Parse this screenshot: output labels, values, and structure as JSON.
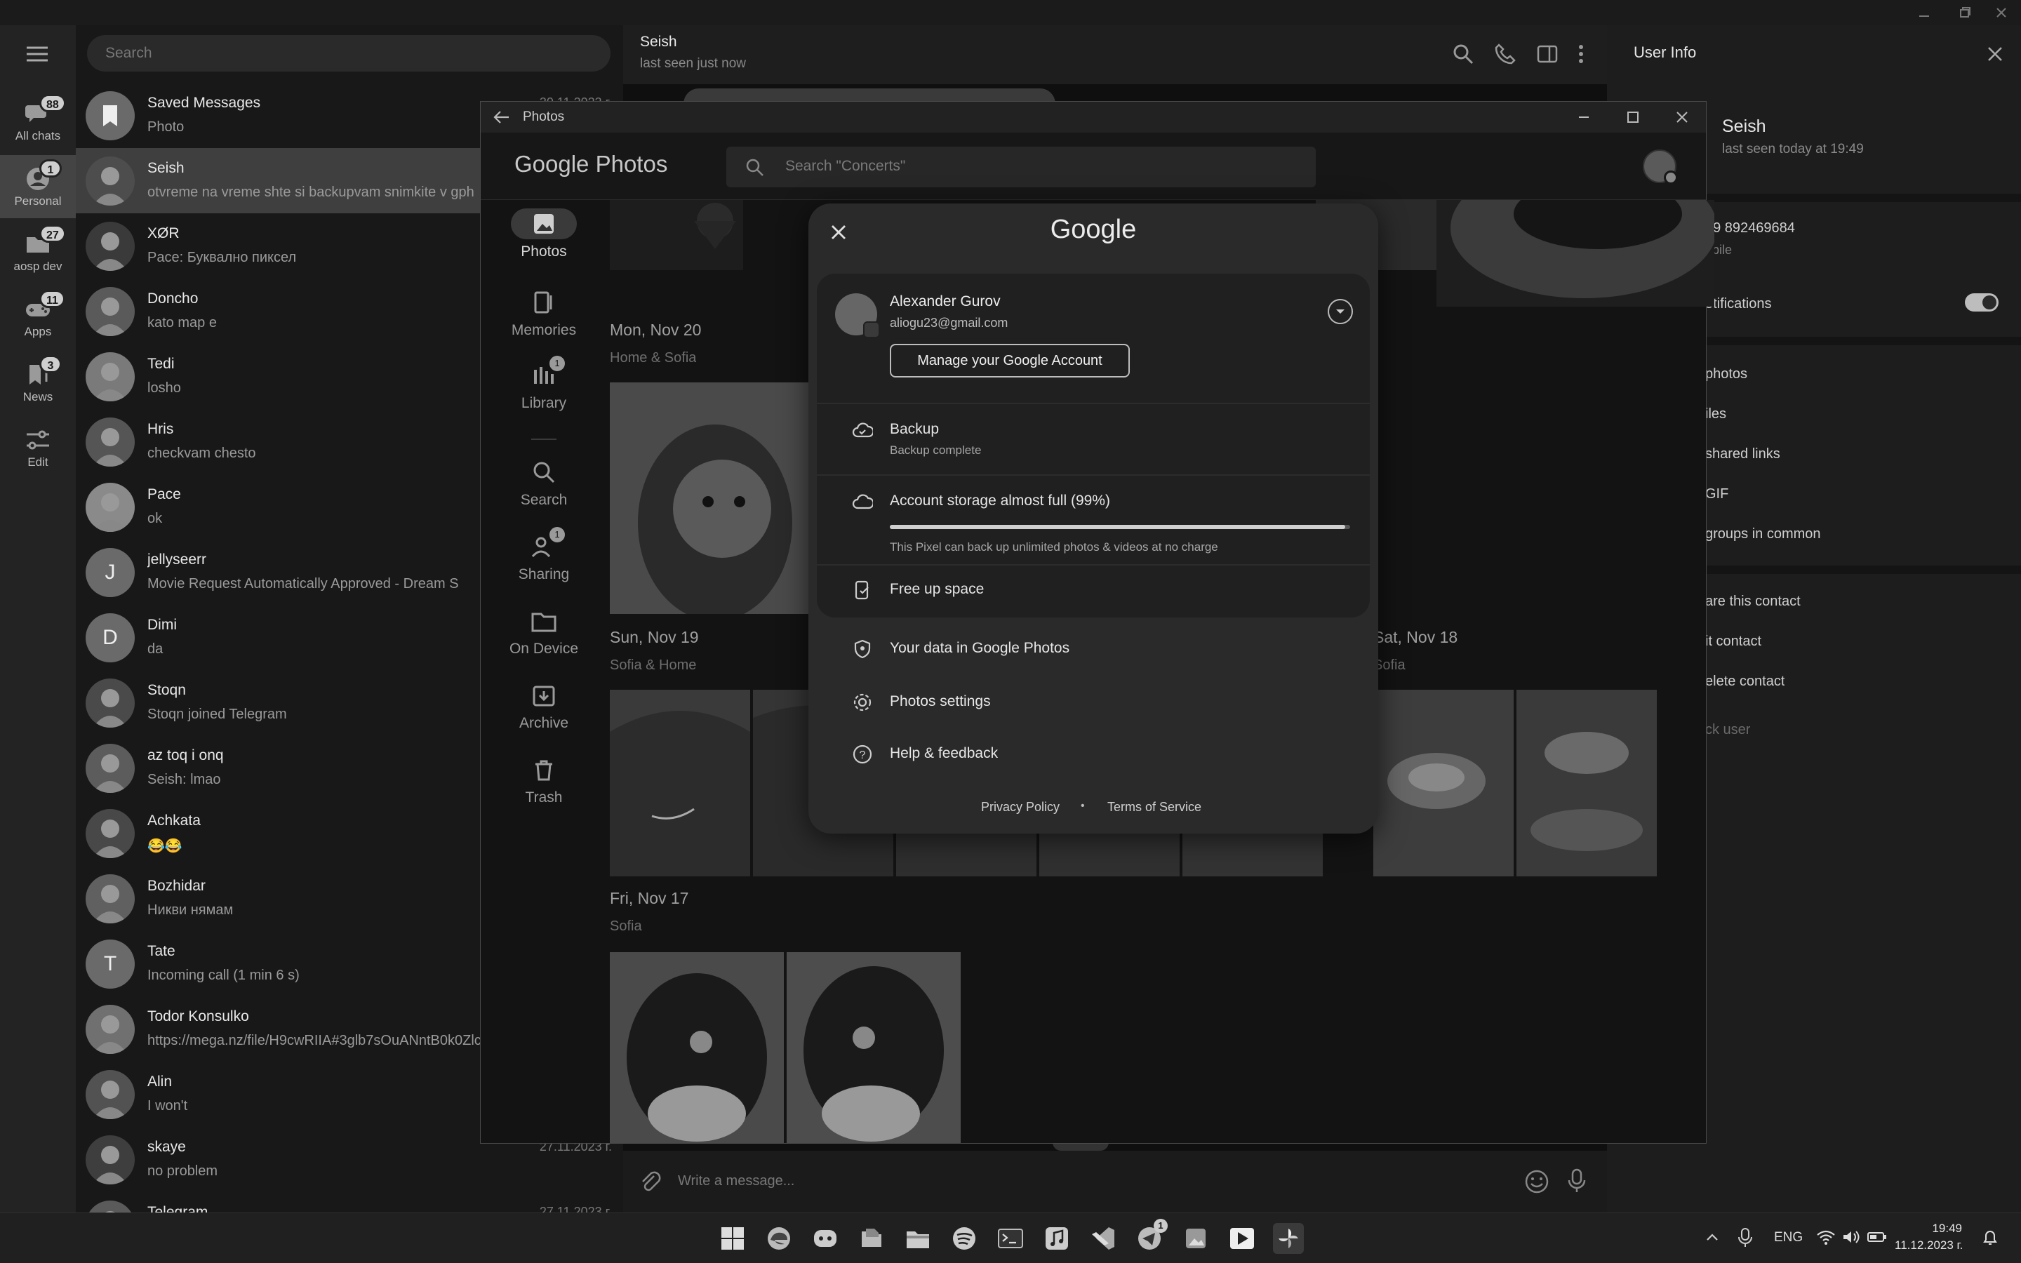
{
  "telegram": {
    "search_placeholder": "Search",
    "rail": [
      {
        "label": "All chats",
        "badge": "88",
        "icon": "chats-icon"
      },
      {
        "label": "Personal",
        "badge": "1",
        "icon": "person-icon"
      },
      {
        "label": "aosp dev",
        "badge": "27",
        "icon": "folder-icon"
      },
      {
        "label": "Apps",
        "badge": "11",
        "icon": "gamepad-icon"
      },
      {
        "label": "News",
        "badge": "3",
        "icon": "news-icon"
      },
      {
        "label": "Edit",
        "badge": "",
        "icon": "sliders-icon"
      }
    ],
    "chats": [
      {
        "name": "Saved Messages",
        "message": "Photo",
        "date": "30.11.2023 г.",
        "letter": ""
      },
      {
        "name": "Seish",
        "message": "otvreme na vreme shte si backupvam snimkite v gph",
        "date": "",
        "letter": ""
      },
      {
        "name": "XØR",
        "message": "Pace: Буквално пиксел",
        "date": "",
        "letter": ""
      },
      {
        "name": "Doncho",
        "message": "kato map e",
        "date": "",
        "letter": ""
      },
      {
        "name": "Tedi",
        "message": "losho",
        "date": "",
        "letter": ""
      },
      {
        "name": "Hris",
        "message": "checkvam chesto",
        "date": "",
        "letter": ""
      },
      {
        "name": "Pace",
        "message": "ok",
        "date": "",
        "letter": ""
      },
      {
        "name": "jellyseerr",
        "message": "Movie Request Automatically Approved - Dream S",
        "date": "",
        "letter": "J"
      },
      {
        "name": "Dimi",
        "message": "da",
        "date": "",
        "letter": "D"
      },
      {
        "name": "Stoqn",
        "message": "Stoqn joined Telegram",
        "date": "",
        "letter": ""
      },
      {
        "name": "az toq i onq",
        "message": "Seish: lmao",
        "date": "",
        "letter": ""
      },
      {
        "name": "Achkata",
        "message": "😂😂",
        "date": "",
        "letter": ""
      },
      {
        "name": "Bozhidar",
        "message": "Никви нямам",
        "date": "",
        "letter": ""
      },
      {
        "name": "Tate",
        "message": "Incoming call (1 min 6 s)",
        "date": "",
        "letter": "T"
      },
      {
        "name": "Todor Konsulko",
        "message": "https://mega.nz/file/H9cwRIIA#3glb7sOuANntB0k0Zlc",
        "date": "",
        "letter": ""
      },
      {
        "name": "Alin",
        "message": "I won't",
        "date": "",
        "letter": ""
      },
      {
        "name": "skaye",
        "message": "no problem",
        "date": "27.11.2023 г.",
        "letter": ""
      },
      {
        "name": "Telegram",
        "message": "",
        "date": "27.11.2023 г.",
        "letter": ""
      }
    ],
    "conversation": {
      "name": "Seish",
      "status": "last seen just now",
      "composer_placeholder": "Write a message..."
    },
    "user_info": {
      "title": "User Info",
      "name": "Seish",
      "status": "last seen today at 19:49",
      "phone": "59 892469684",
      "phone_label": "obile",
      "notifications": "otifications",
      "media": [
        "photos",
        "iles",
        "shared links",
        "GIF",
        "groups in common"
      ],
      "actions": [
        "are this contact",
        "it contact",
        "elete contact",
        "ck user"
      ]
    }
  },
  "photos": {
    "window_title": "Photos",
    "app_name": "Google Photos",
    "search_placeholder": "Search \"Concerts\"",
    "nav": [
      {
        "label": "Photos",
        "icon": "photos-icon",
        "badge": ""
      },
      {
        "label": "Memories",
        "icon": "memories-icon",
        "badge": ""
      },
      {
        "label": "Library",
        "icon": "library-icon",
        "badge": "1"
      },
      {
        "label": "Search",
        "icon": "search-icon",
        "badge": ""
      },
      {
        "label": "Sharing",
        "icon": "sharing-icon",
        "badge": "1"
      },
      {
        "label": "On Device",
        "icon": "folder-icon",
        "badge": ""
      },
      {
        "label": "Archive",
        "icon": "archive-icon",
        "badge": ""
      },
      {
        "label": "Trash",
        "icon": "trash-icon",
        "badge": ""
      }
    ],
    "groups": [
      {
        "date": "Mon, Nov 20",
        "place": "Home & Sofia"
      },
      {
        "date": "Sun, Nov 19",
        "place": "Sofia & Home"
      },
      {
        "date": "Sat, Nov 18",
        "place": "Sofia"
      },
      {
        "date": "Fri, Nov 17",
        "place": "Sofia"
      }
    ]
  },
  "account_popup": {
    "logo": "Google",
    "account_name": "Alexander Gurov",
    "account_email": "aliogu23@gmail.com",
    "manage_button": "Manage your Google Account",
    "backup_title": "Backup",
    "backup_status": "Backup complete",
    "storage_title": "Account storage almost full (99%)",
    "storage_fraction": 0.99,
    "storage_note": "This Pixel can back up unlimited photos & videos at no charge",
    "free_up": "Free up space",
    "your_data": "Your data in Google Photos",
    "settings": "Photos settings",
    "help": "Help & feedback",
    "privacy": "Privacy Policy",
    "dot": "•",
    "terms": "Terms of Service"
  },
  "taskbar": {
    "language": "ENG",
    "time": "19:49",
    "date": "11.12.2023 г.",
    "telegram_badge": "1"
  },
  "colors": {
    "accent": "#cfcfcf",
    "popup_bg": "#2a2a2a",
    "card_bg": "#202020"
  }
}
